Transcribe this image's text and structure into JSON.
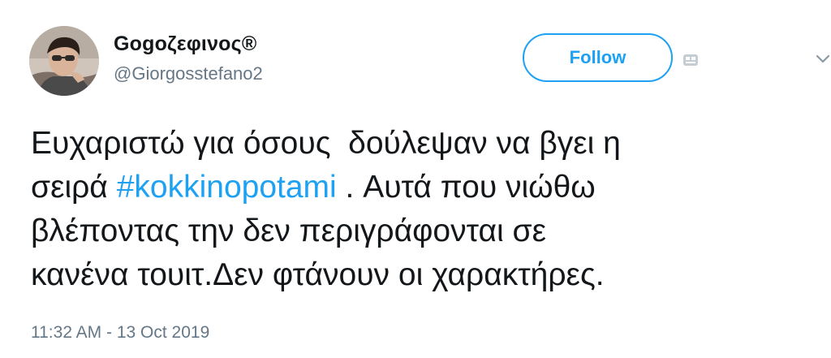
{
  "user": {
    "display_name": "Gogoζεφινος®",
    "handle": "@Giorgosstefano2",
    "avatar_icon": "profile-photo"
  },
  "actions": {
    "follow_label": "Follow",
    "mini_icon": "app-icon",
    "menu_icon": "chevron-down-icon"
  },
  "tweet": {
    "line1": "Ευχαριστώ για όσους  δούλεψαν να βγει η",
    "line2_prefix": "σειρά ",
    "hashtag": "#kokkinopotami",
    "line2_suffix": " . Αυτά που νιώθω",
    "line3": "βλέποντας την δεν περιγράφονται σε",
    "line4": "κανένα τουιτ.Δεν φτάνουν οι χαρακτήρες."
  },
  "timestamp": "11:32 AM - 13 Oct 2019",
  "colors": {
    "accent": "#1da1f2",
    "text": "#14171a",
    "muted": "#657786"
  }
}
